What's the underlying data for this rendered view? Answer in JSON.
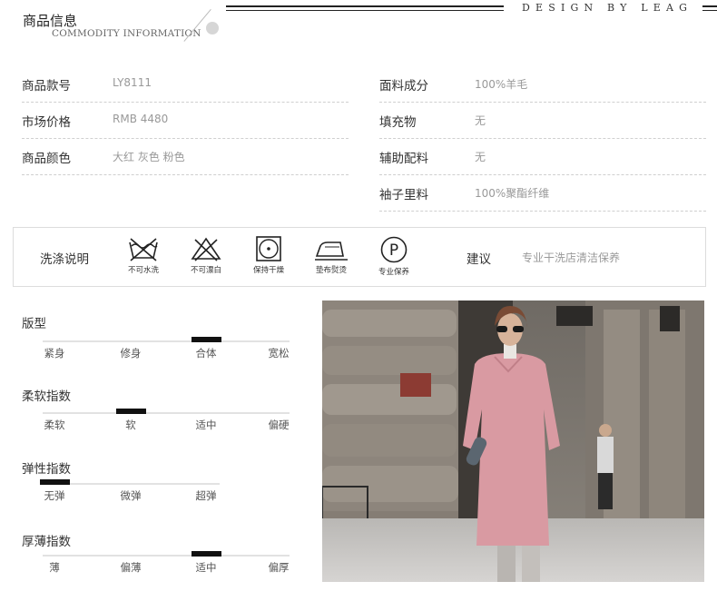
{
  "header": {
    "title": "商品信息",
    "subtitle": "COMMODITY INFORMATION",
    "brand": "DESIGN BY LEAG"
  },
  "specs_left": [
    {
      "label": "商品款号",
      "value": "LY8111"
    },
    {
      "label": "市场价格",
      "value": "RMB 4480"
    },
    {
      "label": "商品颜色",
      "value": "大红 灰色 粉色"
    }
  ],
  "specs_right": [
    {
      "label": "面料成分",
      "value": "100%羊毛"
    },
    {
      "label": "填充物",
      "value": "无"
    },
    {
      "label": "辅助配料",
      "value": "无"
    },
    {
      "label": "袖子里料",
      "value": "100%聚酯纤维"
    }
  ],
  "washing": {
    "label": "洗涤说明",
    "icons": [
      {
        "icon": "no-wash-icon",
        "caption": "不可水洗"
      },
      {
        "icon": "no-bleach-icon",
        "caption": "不可漂白"
      },
      {
        "icon": "tumble-dry-icon",
        "caption": "保持干燥"
      },
      {
        "icon": "iron-with-cloth-icon",
        "caption": "垫布熨烫"
      },
      {
        "icon": "professional-clean-icon",
        "caption": "专业保养"
      }
    ],
    "advice_label": "建议",
    "advice_value": "专业干洗店清洁保养"
  },
  "scales": [
    {
      "title": "版型",
      "options": [
        "紧身",
        "修身",
        "合体",
        "宽松"
      ],
      "selected_index": 2
    },
    {
      "title": "柔软指数",
      "options": [
        "柔软",
        "软",
        "适中",
        "偏硬"
      ],
      "selected_index": 1
    },
    {
      "title": "弹性指数",
      "options": [
        "无弹",
        "微弹",
        "超弹"
      ],
      "selected_index": 0
    },
    {
      "title": "厚薄指数",
      "options": [
        "薄",
        "偏薄",
        "适中",
        "偏厚"
      ],
      "selected_index": 2
    }
  ],
  "colors": {
    "coat_pink": "#d99aa2",
    "stone": "#8d857c",
    "marker": "#111111"
  }
}
